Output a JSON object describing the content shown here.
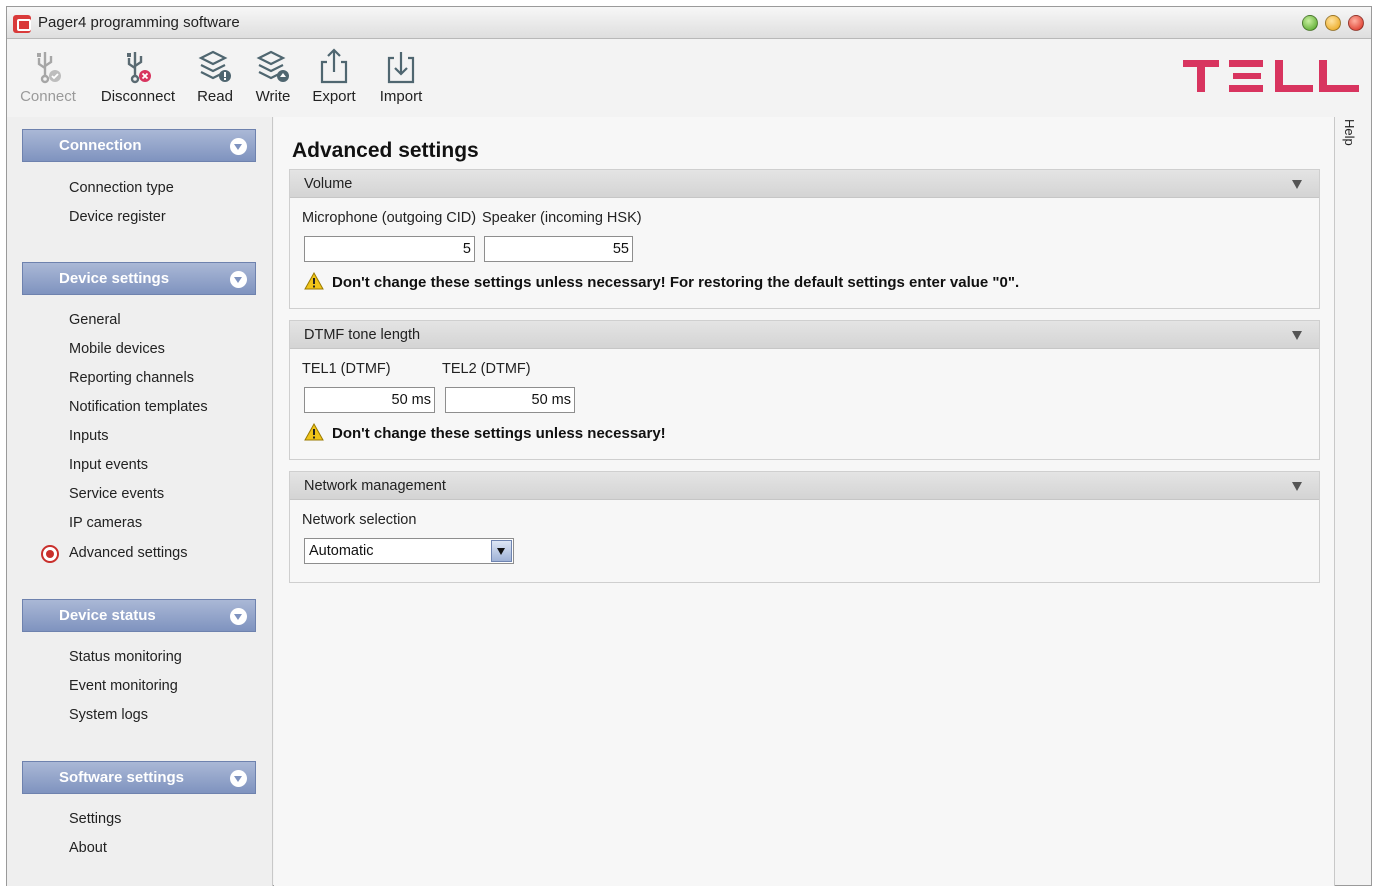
{
  "window": {
    "title": "Pager4 programming software"
  },
  "toolbar": {
    "connect_label": "Connect",
    "disconnect_label": "Disconnect",
    "read_label": "Read",
    "write_label": "Write",
    "export_label": "Export",
    "import_label": "Import",
    "connect_enabled": false
  },
  "brand": {
    "logo_text": "TELL",
    "logo_color": "#d8345f"
  },
  "help_tab": "Help",
  "sidebar": {
    "groups": [
      {
        "title": "Connection",
        "items": [
          "Connection type",
          "Device register"
        ]
      },
      {
        "title": "Device settings",
        "items": [
          "General",
          "Mobile devices",
          "Reporting channels",
          "Notification templates",
          "Inputs",
          "Input events",
          "Service events",
          "IP cameras",
          "Advanced settings"
        ]
      },
      {
        "title": "Device status",
        "items": [
          "Status monitoring",
          "Event monitoring",
          "System logs"
        ]
      },
      {
        "title": "Software settings",
        "items": [
          "Settings",
          "About"
        ]
      }
    ],
    "selected_item": "Advanced settings"
  },
  "main": {
    "title": "Advanced settings",
    "sections": [
      {
        "title": "Volume",
        "fields": [
          {
            "label": "Microphone (outgoing CID)",
            "value": "5"
          },
          {
            "label": "Speaker (incoming HSK)",
            "value": "55"
          }
        ],
        "warning": "Don't change these settings unless necessary! For restoring the default settings enter value \"0\"."
      },
      {
        "title": "DTMF tone length",
        "fields": [
          {
            "label": "TEL1 (DTMF)",
            "value": "50 ms"
          },
          {
            "label": "TEL2 (DTMF)",
            "value": "50 ms"
          }
        ],
        "warning": "Don't change these settings unless necessary!"
      },
      {
        "title": "Network management",
        "fields": [
          {
            "label": "Network selection",
            "value": "Automatic"
          }
        ]
      }
    ]
  },
  "colors": {
    "sidebar_header": "#8fa2c9",
    "selected_marker": "#c9302c",
    "warning_icon": "#f0c419"
  },
  "icons": {
    "connect": "usb-plug-icon",
    "disconnect": "usb-disconnect-icon",
    "read": "database-read-icon",
    "write": "database-write-icon",
    "export": "export-upload-icon",
    "import": "import-download-icon",
    "warning": "warning-triangle-icon"
  }
}
